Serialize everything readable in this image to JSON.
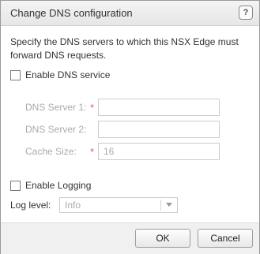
{
  "dialog": {
    "title": "Change DNS configuration",
    "help_icon": "?",
    "description": "Specify the DNS servers to which this NSX Edge must forward DNS requests.",
    "enable_dns": {
      "label": "Enable DNS service",
      "checked": false
    },
    "fields": {
      "dns1": {
        "label": "DNS Server 1:",
        "required": true,
        "value": ""
      },
      "dns2": {
        "label": "DNS Server 2:",
        "required": false,
        "value": ""
      },
      "cache": {
        "label": "Cache Size:",
        "required": true,
        "value": "16"
      }
    },
    "required_mark": "*",
    "enable_logging": {
      "label": "Enable Logging",
      "checked": false
    },
    "log_level": {
      "label": "Log level:",
      "value": "Info"
    },
    "buttons": {
      "ok": "OK",
      "cancel": "Cancel"
    }
  },
  "icons": {
    "help": "help-icon",
    "dropdown": "chevron-down-icon"
  },
  "colors": {
    "required": "#e06060",
    "disabled_text": "#aaaaaa"
  }
}
